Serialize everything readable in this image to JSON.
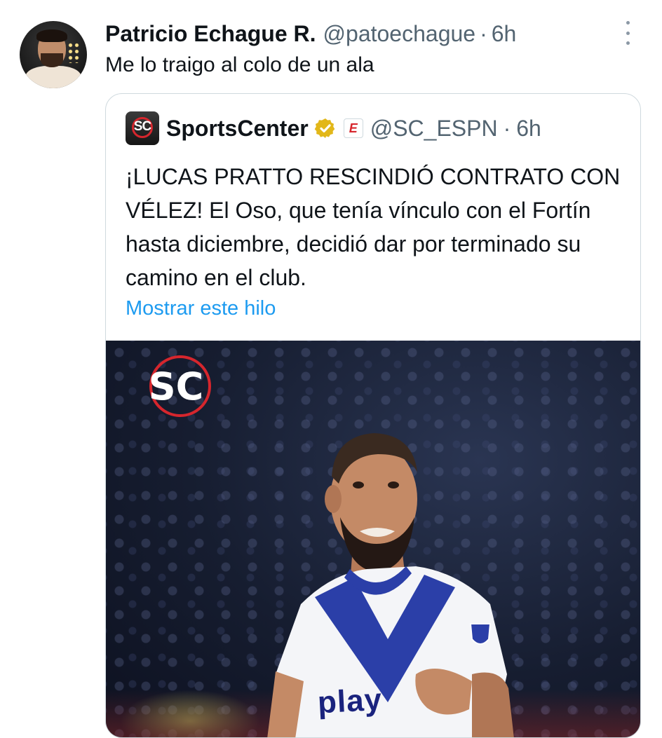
{
  "tweet": {
    "author_name": "Patricio Echague R.",
    "author_handle": "@patoechague",
    "separator": "·",
    "time": "6h",
    "text": "Me lo traigo al colo de un ala"
  },
  "quoted": {
    "avatar_text": "SC",
    "name": "SportsCenter",
    "affiliate_badge": "E",
    "handle": "@SC_ESPN",
    "separator": "·",
    "time": "6h",
    "text": "¡LUCAS PRATTO RESCINDIÓ CONTRATO CON VÉLEZ! El Oso, que tenía vínculo con el Fortín hasta diciembre, decidió dar por terminado su camino en el club.",
    "show_thread": "Mostrar este hilo",
    "media": {
      "logo_text": "SC",
      "shirt_text": "play"
    }
  },
  "colors": {
    "text_primary": "#0f1419",
    "text_secondary": "#536471",
    "link": "#1d9bf0",
    "border": "#cfd9de",
    "verified_gold": "#e2b719",
    "espn_red": "#d6262d"
  },
  "icons": {
    "more": "more-vertical-icon",
    "verified": "verified-badge-icon",
    "affiliate": "espn-affiliate-icon"
  }
}
